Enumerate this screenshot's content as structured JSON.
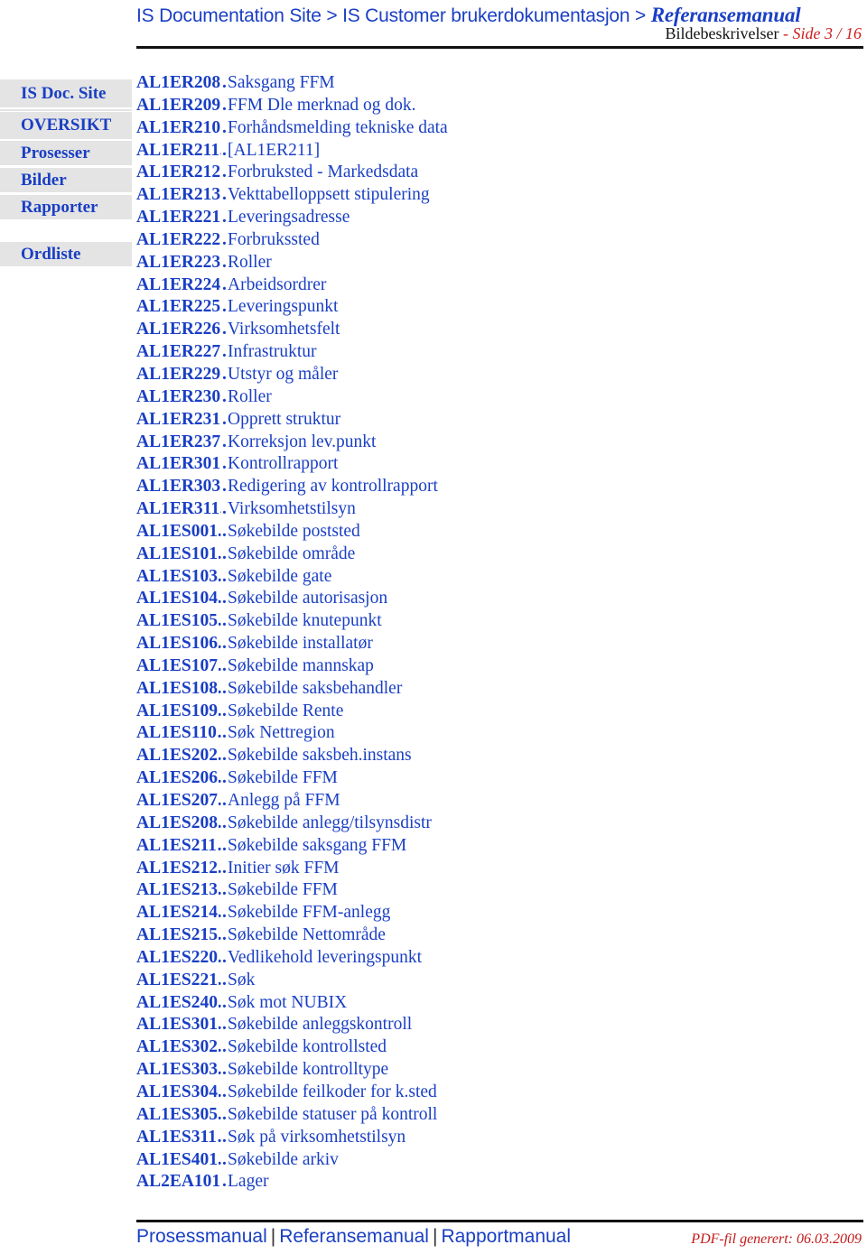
{
  "header": {
    "breadcrumb": [
      {
        "label": "IS Documentation Site"
      },
      {
        "label": "IS Customer brukerdokumentasjon"
      },
      {
        "label": "Referansemanual"
      }
    ],
    "separator": ">",
    "section": "Bildebeskrivelser",
    "page_sep": " - ",
    "page": "Side 3 / 16"
  },
  "sidebar": {
    "items": [
      {
        "label": "IS Doc. Site"
      },
      {
        "label": "OVERSIKT"
      },
      {
        "label": "Prosesser"
      },
      {
        "label": "Bilder"
      },
      {
        "label": "Rapporter"
      },
      {
        "label": "Ordliste"
      }
    ]
  },
  "toc": {
    "dots": "..................................",
    "entries": [
      {
        "code": "AL1ER208",
        "desc": "Saksgang FFM"
      },
      {
        "code": "AL1ER209",
        "desc": "FFM Dle merknad og dok."
      },
      {
        "code": "AL1ER210",
        "desc": "Forhåndsmelding tekniske data"
      },
      {
        "code": "AL1ER211",
        "desc": "[AL1ER211]"
      },
      {
        "code": "AL1ER212",
        "desc": "Forbruksted - Markedsdata"
      },
      {
        "code": "AL1ER213",
        "desc": "Vekttabelloppsett stipulering"
      },
      {
        "code": "AL1ER221",
        "desc": "Leveringsadresse"
      },
      {
        "code": "AL1ER222",
        "desc": "Forbrukssted"
      },
      {
        "code": "AL1ER223",
        "desc": "Roller"
      },
      {
        "code": "AL1ER224",
        "desc": "Arbeidsordrer"
      },
      {
        "code": "AL1ER225",
        "desc": "Leveringspunkt"
      },
      {
        "code": "AL1ER226",
        "desc": "Virksomhetsfelt"
      },
      {
        "code": "AL1ER227",
        "desc": "Infrastruktur"
      },
      {
        "code": "AL1ER229",
        "desc": "Utstyr og måler"
      },
      {
        "code": "AL1ER230",
        "desc": "Roller"
      },
      {
        "code": "AL1ER231",
        "desc": "Opprett struktur"
      },
      {
        "code": "AL1ER237",
        "desc": "Korreksjon lev.punkt"
      },
      {
        "code": "AL1ER301",
        "desc": "Kontrollrapport"
      },
      {
        "code": "AL1ER303",
        "desc": "Redigering av kontrollrapport"
      },
      {
        "code": "AL1ER311",
        "desc": "Virksomhetstilsyn"
      },
      {
        "code": "AL1ES001",
        "desc": "Søkebilde poststed"
      },
      {
        "code": "AL1ES101",
        "desc": "Søkebilde område"
      },
      {
        "code": "AL1ES103",
        "desc": "Søkebilde gate"
      },
      {
        "code": "AL1ES104",
        "desc": "Søkebilde autorisasjon"
      },
      {
        "code": "AL1ES105",
        "desc": "Søkebilde knutepunkt"
      },
      {
        "code": "AL1ES106",
        "desc": "Søkebilde installatør"
      },
      {
        "code": "AL1ES107",
        "desc": "Søkebilde mannskap"
      },
      {
        "code": "AL1ES108",
        "desc": "Søkebilde saksbehandler"
      },
      {
        "code": "AL1ES109",
        "desc": "Søkebilde Rente"
      },
      {
        "code": "AL1ES110",
        "desc": "Søk Nettregion"
      },
      {
        "code": "AL1ES202",
        "desc": "Søkebilde saksbeh.instans"
      },
      {
        "code": "AL1ES206",
        "desc": "Søkebilde FFM"
      },
      {
        "code": "AL1ES207",
        "desc": "Anlegg på FFM"
      },
      {
        "code": "AL1ES208",
        "desc": "Søkebilde anlegg/tilsynsdistr"
      },
      {
        "code": "AL1ES211",
        "desc": "Søkebilde saksgang FFM"
      },
      {
        "code": "AL1ES212",
        "desc": "Initier søk FFM"
      },
      {
        "code": "AL1ES213",
        "desc": "Søkebilde FFM"
      },
      {
        "code": "AL1ES214",
        "desc": "Søkebilde FFM-anlegg"
      },
      {
        "code": "AL1ES215",
        "desc": "Søkebilde Nettområde"
      },
      {
        "code": "AL1ES220",
        "desc": "Vedlikehold leveringspunkt"
      },
      {
        "code": "AL1ES221",
        "desc": "Søk"
      },
      {
        "code": "AL1ES240",
        "desc": "Søk mot NUBIX"
      },
      {
        "code": "AL1ES301",
        "desc": "Søkebilde anleggskontroll"
      },
      {
        "code": "AL1ES302",
        "desc": "Søkebilde kontrollsted"
      },
      {
        "code": "AL1ES303",
        "desc": "Søkebilde kontrolltype"
      },
      {
        "code": "AL1ES304",
        "desc": "Søkebilde feilkoder for k.sted"
      },
      {
        "code": "AL1ES305",
        "desc": "Søkebilde statuser på kontroll"
      },
      {
        "code": "AL1ES311",
        "desc": "Søk på virksomhetstilsyn"
      },
      {
        "code": "AL1ES401",
        "desc": "Søkebilde arkiv"
      },
      {
        "code": "AL2EA101",
        "desc": "Lager"
      }
    ]
  },
  "footer": {
    "links": [
      {
        "label": "Prosessmanual"
      },
      {
        "label": "Referansemanual"
      },
      {
        "label": "Rapportmanual"
      }
    ],
    "pipe": "|",
    "generated": "PDF-fil generert: 06.03.2009"
  },
  "colors": {
    "link": "#1a3fc4",
    "accent_red": "#cc1f1f",
    "sidebar_bg": "#e4e4e4"
  }
}
